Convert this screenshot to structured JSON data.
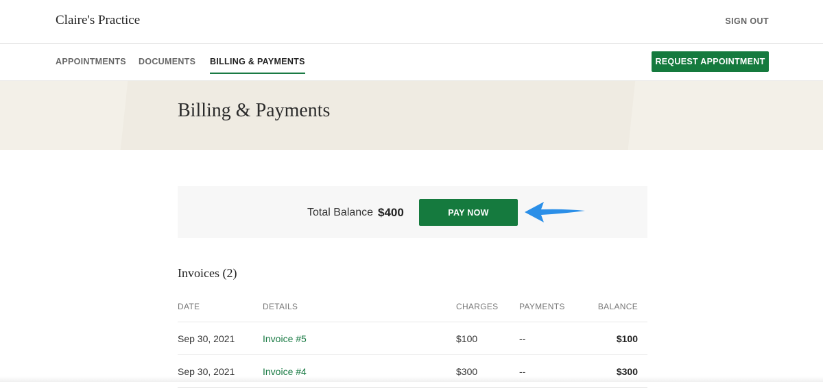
{
  "header": {
    "brand": "Claire's Practice",
    "sign_out": "SIGN OUT"
  },
  "nav": {
    "tabs": [
      {
        "label": "APPOINTMENTS",
        "active": false
      },
      {
        "label": "DOCUMENTS",
        "active": false
      },
      {
        "label": "BILLING & PAYMENTS",
        "active": true
      }
    ],
    "request_button": "REQUEST APPOINTMENT"
  },
  "hero": {
    "title": "Billing & Payments"
  },
  "balance": {
    "label": "Total Balance",
    "value": "$400",
    "pay_button": "PAY NOW"
  },
  "invoices": {
    "title": "Invoices (2)",
    "columns": [
      "DATE",
      "DETAILS",
      "CHARGES",
      "PAYMENTS",
      "BALANCE"
    ],
    "rows": [
      {
        "date": "Sep 30, 2021",
        "details": "Invoice #5",
        "charges": "$100",
        "payments": "--",
        "balance": "$100"
      },
      {
        "date": "Sep 30, 2021",
        "details": "Invoice #4",
        "charges": "$300",
        "payments": "--",
        "balance": "$300"
      }
    ]
  },
  "colors": {
    "accent": "#157a3e",
    "annotation_arrow": "#2b8fe8",
    "hero_bg": "#f3f0e8"
  },
  "icons": {
    "annotation": "arrow-left-icon"
  }
}
